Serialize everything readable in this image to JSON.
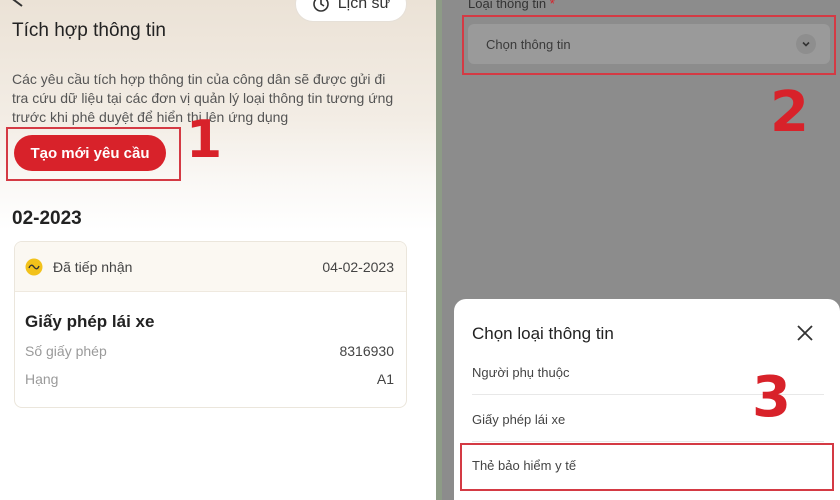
{
  "left": {
    "history_label": "Lịch sử",
    "page_title": "Tích hợp thông tin",
    "description": "Các yêu cầu tích hợp thông tin của công dân sẽ được gửi đi tra cứu dữ liệu tại các đơn vị quản lý loại thông tin tương ứng trước khi phê duyệt để hiển thị lên ứng dụng",
    "new_request_label": "Tạo mới yêu cầu",
    "step_number": "1",
    "month": "02-2023",
    "card": {
      "status": "Đã tiếp nhận",
      "date": "04-02-2023",
      "title": "Giấy phép lái xe",
      "rows": [
        {
          "key": "Số giấy phép",
          "value": "8316930"
        },
        {
          "key": "Hạng",
          "value": "A1"
        }
      ]
    }
  },
  "right": {
    "field_label": "Loại thông tin",
    "required_mark": "*",
    "select_placeholder": "Chọn thông tin",
    "step_number_select": "2",
    "sheet_title": "Chọn loại thông tin",
    "options": [
      "Người phụ thuộc",
      "Giấy phép lái xe",
      "Thẻ bảo hiểm y tế"
    ],
    "step_number_option": "3"
  },
  "colors": {
    "accent_red": "#d8222a",
    "highlight_border": "#d43a44",
    "status_yellow": "#f2c21b",
    "overlay_gray": "#8c8c8c"
  },
  "icons": [
    "back-arrow-icon",
    "history-icon",
    "status-icon",
    "chevron-down-icon",
    "close-icon"
  ]
}
